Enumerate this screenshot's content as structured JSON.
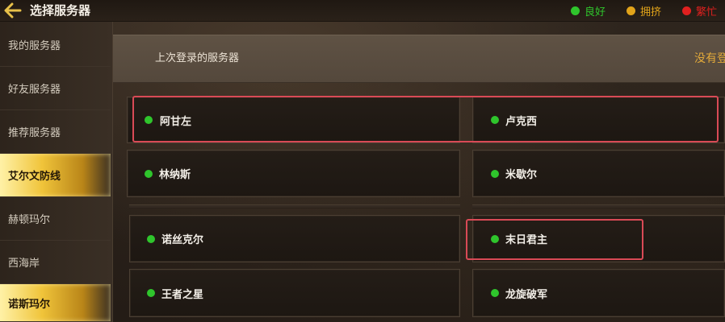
{
  "header": {
    "title": "选择服务器",
    "back_icon": "back-arrow-icon",
    "legend": [
      {
        "label": "良好",
        "color": "#2fc52c"
      },
      {
        "label": "拥挤",
        "color": "#e2a41a"
      },
      {
        "label": "繁忙",
        "color": "#e0201f"
      }
    ]
  },
  "sidebar": {
    "items": [
      {
        "label": "我的服务器",
        "active": false
      },
      {
        "label": "好友服务器",
        "active": false
      },
      {
        "label": "推荐服务器",
        "active": false
      },
      {
        "label": "艾尔文防线",
        "active": true
      },
      {
        "label": "赫顿玛尔",
        "active": false
      },
      {
        "label": "西海岸",
        "active": false
      },
      {
        "label": "诺斯玛尔",
        "active": true
      }
    ]
  },
  "last_login": {
    "label": "上次登录的服务器",
    "value": "没有登"
  },
  "servers": [
    {
      "name": "阿甘左",
      "status": "良好"
    },
    {
      "name": "卢克西",
      "status": "良好"
    },
    {
      "name": "林纳斯",
      "status": "良好"
    },
    {
      "name": "米歇尔",
      "status": "良好"
    },
    {
      "name": "诺丝克尔",
      "status": "良好"
    },
    {
      "name": "末日君主",
      "status": "良好"
    },
    {
      "name": "王者之星",
      "status": "良好"
    },
    {
      "name": "龙旋破军",
      "status": "良好"
    }
  ],
  "colors": {
    "status_good": "#2fc52c",
    "status_crowded": "#e2a41a",
    "status_busy": "#e0201f",
    "highlight_border": "#d94a56",
    "accent_gold": "#e3aa3a"
  }
}
